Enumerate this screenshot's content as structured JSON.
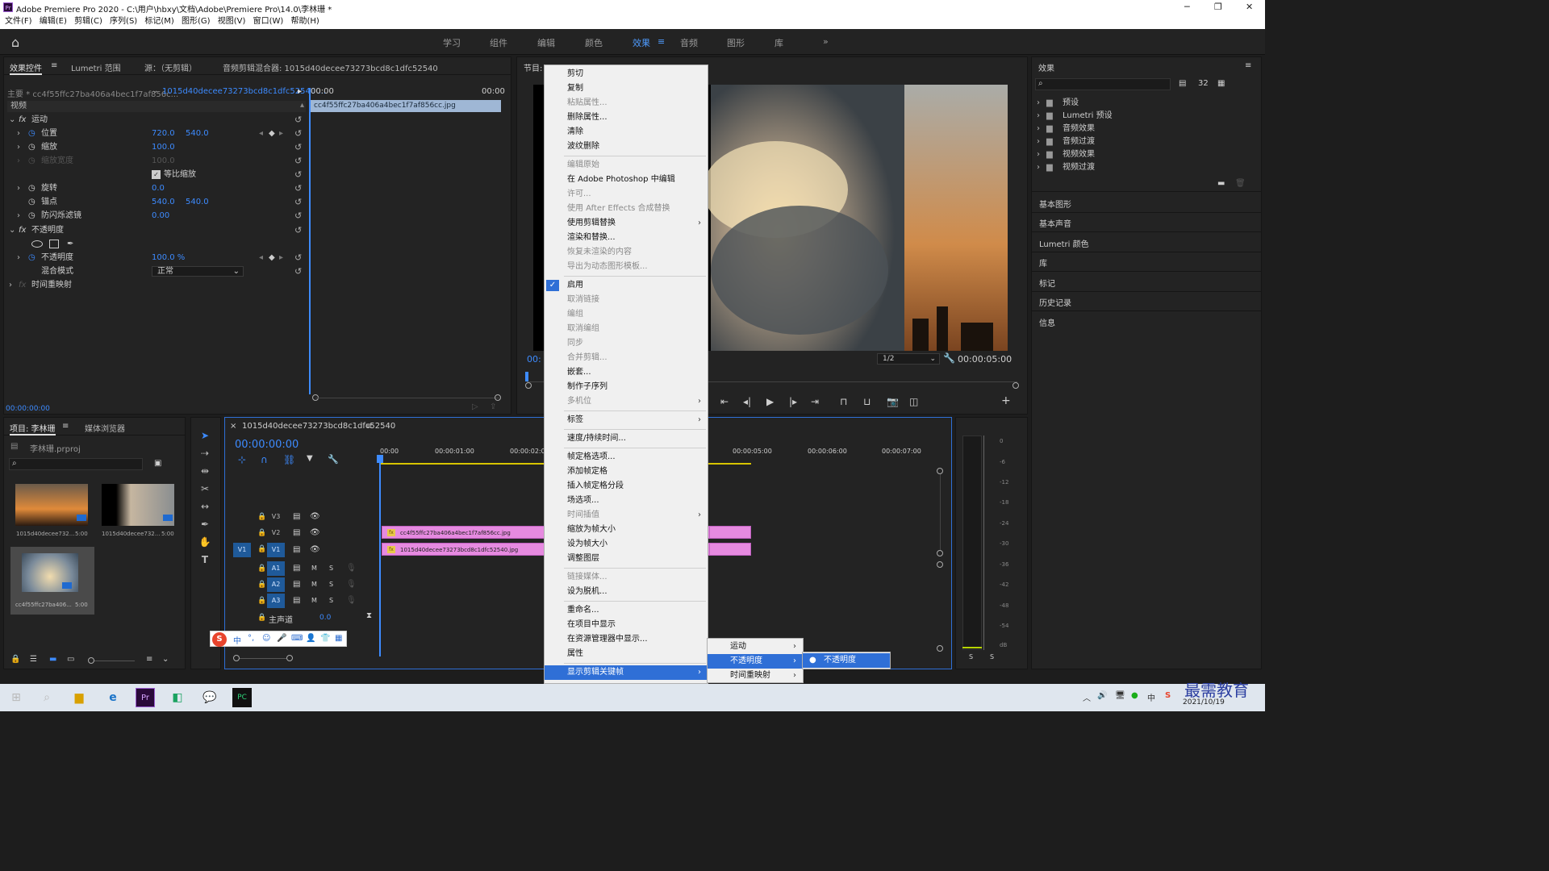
{
  "window": {
    "title": "Adobe Premiere Pro 2020 - C:\\用户\\hbxy\\文档\\Adobe\\Premiere Pro\\14.0\\李林珊 *",
    "app_icon": "Pr",
    "controls": [
      "─",
      "❐",
      "✕"
    ]
  },
  "menubar": [
    "文件(F)",
    "编辑(E)",
    "剪辑(C)",
    "序列(S)",
    "标记(M)",
    "图形(G)",
    "视图(V)",
    "窗口(W)",
    "帮助(H)"
  ],
  "workspaces": {
    "items": [
      "学习",
      "组件",
      "编辑",
      "颜色",
      "效果",
      "音频",
      "图形",
      "库"
    ],
    "active": "效果",
    "more": "»"
  },
  "effect_controls": {
    "tabs": [
      "效果控件",
      "Lumetri 范围",
      "源：（无剪辑）",
      "音频剪辑混合器: 1015d40decee73273bcd8c1dfc52540"
    ],
    "clip_left": "主要 * cc4f55ffc27ba406a4bec1f7af856c...",
    "clip_right": "1015d40decee73273bcd8c1dfc52540 ...",
    "time_start": "00:00",
    "time_end": "00:00",
    "clip_bar_label": "cc4f55ffc27ba406a4bec1f7af856cc.jpg",
    "section_video": "视频",
    "motion": "运动",
    "position": "位置",
    "position_x": "720.0",
    "position_y": "540.0",
    "scale": "缩放",
    "scale_val": "100.0",
    "scale_width": "缩放宽度",
    "scale_width_val": "100.0",
    "uniform_scale": "等比缩放",
    "rotation": "旋转",
    "rotation_val": "0.0",
    "anchor": "锚点",
    "anchor_x": "540.0",
    "anchor_y": "540.0",
    "antiflicker": "防闪烁滤镜",
    "antiflicker_val": "0.00",
    "opacity_group": "不透明度",
    "opacity": "不透明度",
    "opacity_val": "100.0 %",
    "blend_mode": "混合模式",
    "blend_val": "正常",
    "time_remap": "时间重映射",
    "timecode": "00:00:00:00"
  },
  "program": {
    "tab": "节目: 1015d40decee73273bcd8c1dfc52540",
    "timecode_left": "00:",
    "zoom": "1/2",
    "duration": "00:00:05:00"
  },
  "effects_panel": {
    "title": "效果",
    "tree": [
      "预设",
      "Lumetri 预设",
      "音频效果",
      "音频过渡",
      "视频效果",
      "视频过渡"
    ],
    "sections": [
      "基本图形",
      "基本声音",
      "Lumetri 颜色",
      "库",
      "标记",
      "历史记录",
      "信息"
    ]
  },
  "project": {
    "tabs": [
      "项目: 李林珊",
      "媒体浏览器"
    ],
    "file": "李林珊.prproj",
    "items": [
      {
        "name": "1015d40decee732...",
        "dur": "5:00"
      },
      {
        "name": "1015d40decee732...",
        "dur": "5:00"
      },
      {
        "name": "cc4f55ffc27ba406...",
        "dur": "5:00"
      }
    ]
  },
  "timeline": {
    "tab": "1015d40decee73273bcd8c1dfc52540",
    "timecode": "00:00:00:00",
    "ruler": [
      "00:00",
      "00:00:01:00",
      "00:00:02:0",
      "00:00:05:00",
      "00:00:06:00",
      "00:00:07:00"
    ],
    "video_tracks": [
      "V3",
      "V2",
      "V1"
    ],
    "audio_tracks": [
      "A1",
      "A2",
      "A3"
    ],
    "source_v": "V1",
    "master": "主声道",
    "master_val": "0.0",
    "clip_v2": "cc4f55ffc27ba406a4bec1f7af856cc.jpg",
    "clip_v1": "1015d40decee73273bcd8c1dfc52540.jpg",
    "m": "M",
    "s": "S"
  },
  "meter": {
    "scale": [
      "0",
      "-6",
      "-12",
      "-18",
      "-24",
      "-30",
      "-36",
      "-42",
      "-48",
      "-54",
      "dB"
    ],
    "solo": [
      "S",
      "S"
    ]
  },
  "context_menu": {
    "items": [
      {
        "label": "剪切",
        "disabled": false
      },
      {
        "label": "复制",
        "disabled": false
      },
      {
        "label": "粘贴属性...",
        "disabled": true
      },
      {
        "label": "删除属性...",
        "disabled": false
      },
      {
        "label": "清除",
        "disabled": false
      },
      {
        "label": "波纹删除",
        "disabled": false
      },
      {
        "sep": true
      },
      {
        "label": "编辑原始",
        "disabled": true
      },
      {
        "label": "在 Adobe Photoshop 中编辑",
        "disabled": false
      },
      {
        "label": "许可...",
        "disabled": true
      },
      {
        "label": "使用 After Effects 合成替换",
        "disabled": true
      },
      {
        "label": "使用剪辑替换",
        "disabled": false,
        "sub": true
      },
      {
        "label": "渲染和替换...",
        "disabled": false
      },
      {
        "label": "恢复未渲染的内容",
        "disabled": true
      },
      {
        "label": "导出为动态图形模板...",
        "disabled": true
      },
      {
        "sep": true
      },
      {
        "label": "启用",
        "disabled": false,
        "checked": true
      },
      {
        "label": "取消链接",
        "disabled": true
      },
      {
        "label": "编组",
        "disabled": true
      },
      {
        "label": "取消编组",
        "disabled": true
      },
      {
        "label": "同步",
        "disabled": true
      },
      {
        "label": "合并剪辑...",
        "disabled": true
      },
      {
        "label": "嵌套...",
        "disabled": false
      },
      {
        "label": "制作子序列",
        "disabled": false
      },
      {
        "label": "多机位",
        "disabled": true,
        "sub": true
      },
      {
        "sep": true
      },
      {
        "label": "标签",
        "disabled": false,
        "sub": true
      },
      {
        "sep": true
      },
      {
        "label": "速度/持续时间...",
        "disabled": false
      },
      {
        "sep": true
      },
      {
        "label": "帧定格选项...",
        "disabled": false
      },
      {
        "label": "添加帧定格",
        "disabled": false
      },
      {
        "label": "插入帧定格分段",
        "disabled": false
      },
      {
        "label": "场选项...",
        "disabled": false
      },
      {
        "label": "时间插值",
        "disabled": true,
        "sub": true
      },
      {
        "label": "缩放为帧大小",
        "disabled": false
      },
      {
        "label": "设为帧大小",
        "disabled": false
      },
      {
        "label": "调整图层",
        "disabled": false
      },
      {
        "sep": true
      },
      {
        "label": "链接媒体...",
        "disabled": true
      },
      {
        "label": "设为脱机...",
        "disabled": false
      },
      {
        "sep": true
      },
      {
        "label": "重命名...",
        "disabled": false
      },
      {
        "label": "在项目中显示",
        "disabled": false
      },
      {
        "label": "在资源管理器中显示...",
        "disabled": false
      },
      {
        "label": "属性",
        "disabled": false
      },
      {
        "sep": true
      },
      {
        "label": "显示剪辑关键帧",
        "disabled": false,
        "sub": true,
        "highlight": true
      }
    ]
  },
  "submenu1": [
    "运动",
    "不透明度",
    "时间重映射"
  ],
  "submenu2": [
    "不透明度"
  ],
  "ime_bar": [
    "中",
    "°,",
    "☺",
    "🎤",
    "⌨",
    "👤",
    "👕",
    "▦"
  ],
  "taskbar": {
    "date": "2021/10/19",
    "watermark": "最需教育"
  },
  "colors": {
    "accent": "#4f9cff",
    "clip_pink": "#e68ae0",
    "menu_highlight": "#2f6fd6"
  }
}
